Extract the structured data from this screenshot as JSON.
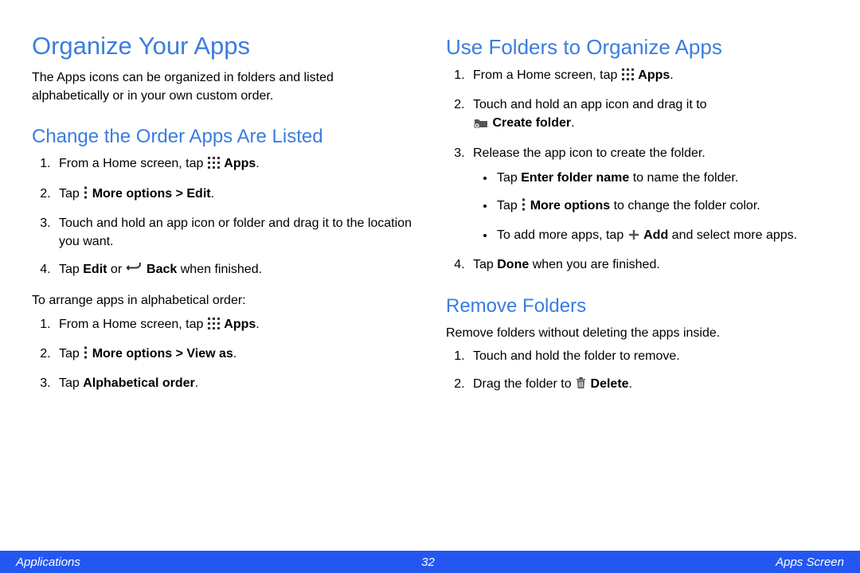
{
  "left": {
    "h1": "Organize Your Apps",
    "intro": "The Apps icons can be organized in folders and listed alphabetically or in your own custom order.",
    "h2a": "Change the Order Apps Are Listed",
    "a1_pre": "From a Home screen, tap ",
    "a1_bold": "Apps",
    "a1_post": ".",
    "a2_pre": "Tap ",
    "a2_bold": "More options > Edit",
    "a2_post": ".",
    "a3": "Touch and hold an app icon or folder and drag it to the location you want.",
    "a4_pre": "Tap ",
    "a4_b1": "Edit",
    "a4_mid": " or ",
    "a4_b2": "Back",
    "a4_post": " when finished.",
    "alpha_intro": "To arrange apps in alphabetical order:",
    "b1_pre": "From a Home screen, tap ",
    "b1_bold": "Apps",
    "b1_post": ".",
    "b2_pre": "Tap ",
    "b2_bold": "More options > View as",
    "b2_post": ".",
    "b3_pre": "Tap ",
    "b3_bold": "Alphabetical order",
    "b3_post": "."
  },
  "right": {
    "h2a": "Use Folders to Organize Apps",
    "c1_pre": "From a Home screen, tap ",
    "c1_bold": "Apps",
    "c1_post": ".",
    "c2_pre": "Touch and hold an app icon and drag it to ",
    "c2_bold": "Create folder",
    "c2_post": ".",
    "c3": "Release the app icon to create the folder.",
    "bul1_pre": "Tap ",
    "bul1_bold": "Enter folder name",
    "bul1_post": " to name the folder.",
    "bul2_pre": "Tap ",
    "bul2_bold": "More options",
    "bul2_post": " to change the folder color.",
    "bul3_pre": "To add more apps, tap ",
    "bul3_bold": "Add",
    "bul3_post": " and select more apps.",
    "c4_pre": "Tap ",
    "c4_bold": "Done",
    "c4_post": " when you are finished.",
    "h2b": "Remove Folders",
    "rem_intro": "Remove folders without deleting the apps inside.",
    "d1": "Touch and hold the folder to remove.",
    "d2_pre": "Drag the folder to ",
    "d2_bold": "Delete",
    "d2_post": "."
  },
  "footer": {
    "left": "Applications",
    "center": "32",
    "right": "Apps Screen"
  }
}
